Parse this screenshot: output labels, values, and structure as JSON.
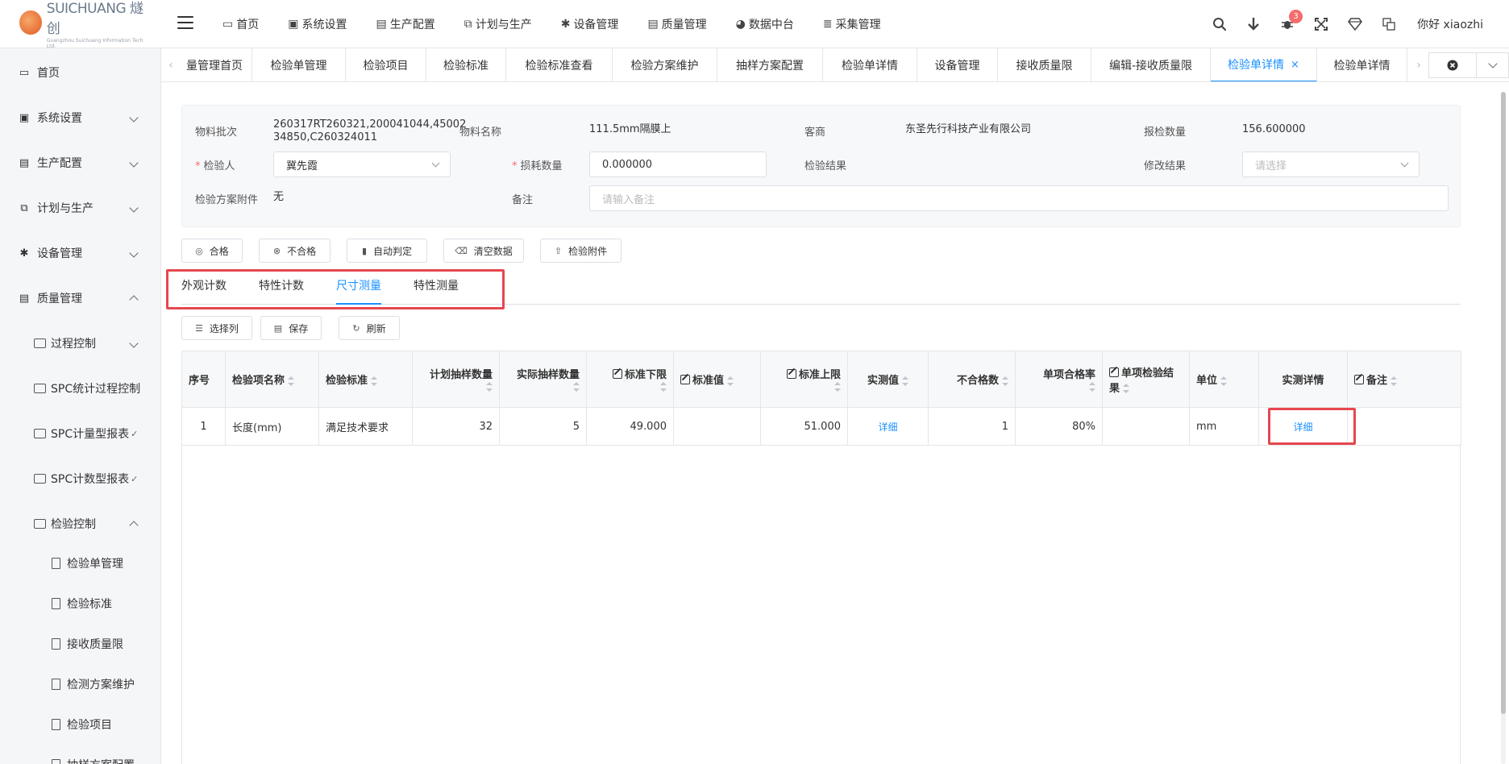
{
  "app": {
    "logo_text": "SUICHUANG 燧创",
    "logo_sub": "Guangzhou Suichuang Information Tech Ltd."
  },
  "topnav": [
    {
      "label": "首页",
      "icon": "monitor-icon",
      "glyph": "▭"
    },
    {
      "label": "系统设置",
      "icon": "user-book-icon",
      "glyph": "▣"
    },
    {
      "label": "生产配置",
      "icon": "briefcase-icon",
      "glyph": "▤"
    },
    {
      "label": "计划与生产",
      "icon": "clone-icon",
      "glyph": "⧉"
    },
    {
      "label": "设备管理",
      "icon": "gear-icon",
      "glyph": "✱"
    },
    {
      "label": "质量管理",
      "icon": "briefcase-icon",
      "glyph": "▤"
    },
    {
      "label": "数据中台",
      "icon": "pie-icon",
      "glyph": "◕"
    },
    {
      "label": "采集管理",
      "icon": "database-icon",
      "glyph": "≣"
    }
  ],
  "topright": {
    "badge_count": "3",
    "greeting": "你好 xiaozhi"
  },
  "sidebar": {
    "items": [
      {
        "label": "首页"
      },
      {
        "label": "系统设置"
      },
      {
        "label": "生产配置"
      },
      {
        "label": "计划与生产"
      },
      {
        "label": "设备管理"
      },
      {
        "label": "质量管理"
      },
      {
        "label": "过程控制"
      },
      {
        "label": "SPC统计过程控制"
      },
      {
        "label": "SPC计量型报表"
      },
      {
        "label": "SPC计数型报表"
      },
      {
        "label": "检验控制"
      },
      {
        "label": "检验单管理"
      },
      {
        "label": "检验标准"
      },
      {
        "label": "接收质量限"
      },
      {
        "label": "检测方案维护"
      },
      {
        "label": "检验项目"
      },
      {
        "label": "抽样方案配置"
      }
    ]
  },
  "tabs": [
    {
      "label": "量管理首页"
    },
    {
      "label": "检验单管理"
    },
    {
      "label": "检验项目"
    },
    {
      "label": "检验标准"
    },
    {
      "label": "检验标准查看"
    },
    {
      "label": "检验方案维护"
    },
    {
      "label": "抽样方案配置"
    },
    {
      "label": "检验单详情"
    },
    {
      "label": "设备管理"
    },
    {
      "label": "接收质量限"
    },
    {
      "label": "编辑-接收质量限"
    },
    {
      "label": "检验单详情",
      "active": true
    },
    {
      "label": "检验单详情"
    }
  ],
  "form": {
    "batch_label": "物料批次",
    "batch_value": "260317RT260321,200041044,4500234850,C260324011",
    "material_label": "物料名称",
    "material_value": "111.5mm隔膜上",
    "vendor_label": "客商",
    "vendor_value": "东圣先行科技产业有限公司",
    "qty_label": "报检数量",
    "qty_value": "156.600000",
    "inspector_label": "检验人",
    "inspector_value": "冀先霞",
    "loss_label": "损耗数量",
    "loss_value": "0.000000",
    "result_label": "检验结果",
    "modify_label": "修改结果",
    "modify_placeholder": "请选择",
    "attach_label": "检验方案附件",
    "attach_value": "无",
    "remark_label": "备注",
    "remark_placeholder": "请输入备注"
  },
  "actions": {
    "pass": "合格",
    "fail": "不合格",
    "auto": "自动判定",
    "clear": "清空数据",
    "attach": "检验附件"
  },
  "inner_tabs": [
    {
      "label": "外观计数"
    },
    {
      "label": "特性计数"
    },
    {
      "label": "尺寸测量",
      "active": true
    },
    {
      "label": "特性测量"
    }
  ],
  "toolbar": {
    "choose_cols": "选择列",
    "save": "保存",
    "refresh": "刷新"
  },
  "table": {
    "headers": [
      "序号",
      "检验项名称",
      "检验标准",
      "计划抽样数量",
      "实际抽样数量",
      "标准下限",
      "标准值",
      "标准上限",
      "实测值",
      "不合格数",
      "单项合格率",
      "单项检验结果",
      "单位",
      "实测详情",
      "备注"
    ],
    "rows": [
      {
        "no": "1",
        "name": "长度(mm)",
        "standard": "满足技术要求",
        "plan_qty": "32",
        "actual_qty": "5",
        "lower": "49.000",
        "std_value": "",
        "upper": "51.000",
        "measured": "详细",
        "ng_count": "1",
        "pass_rate": "80%",
        "result": "",
        "unit": "mm",
        "detail": "详细",
        "remark": ""
      }
    ]
  },
  "colors": {
    "accent": "#1890ff",
    "highlight_box": "#e6474f",
    "badge": "#f56c6c"
  }
}
